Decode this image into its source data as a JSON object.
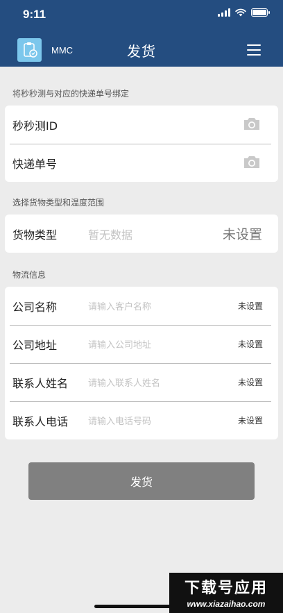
{
  "status_bar": {
    "time": "9:11"
  },
  "header": {
    "app_name": "MMC",
    "title": "发货"
  },
  "bind_section": {
    "label": "将秒秒测与对应的快递单号绑定",
    "rows": [
      {
        "label": "秒秒测ID"
      },
      {
        "label": "快递单号"
      }
    ]
  },
  "goods_section": {
    "label": "选择货物类型和温度范围",
    "goods_type": {
      "label": "货物类型",
      "placeholder": "暂无数据",
      "status": "未设置"
    }
  },
  "logistics_section": {
    "label": "物流信息",
    "rows": [
      {
        "label": "公司名称",
        "placeholder": "请输入客户名称",
        "status": "未设置"
      },
      {
        "label": "公司地址",
        "placeholder": "请输入公司地址",
        "status": "未设置"
      },
      {
        "label": "联系人姓名",
        "placeholder": "请输入联系人姓名",
        "status": "未设置"
      },
      {
        "label": "联系人电话",
        "placeholder": "请输入电话号码",
        "status": "未设置"
      }
    ]
  },
  "submit_label": "发货",
  "watermark": {
    "line1": "下载号应用",
    "line2": "www.xiazaihao.com"
  }
}
